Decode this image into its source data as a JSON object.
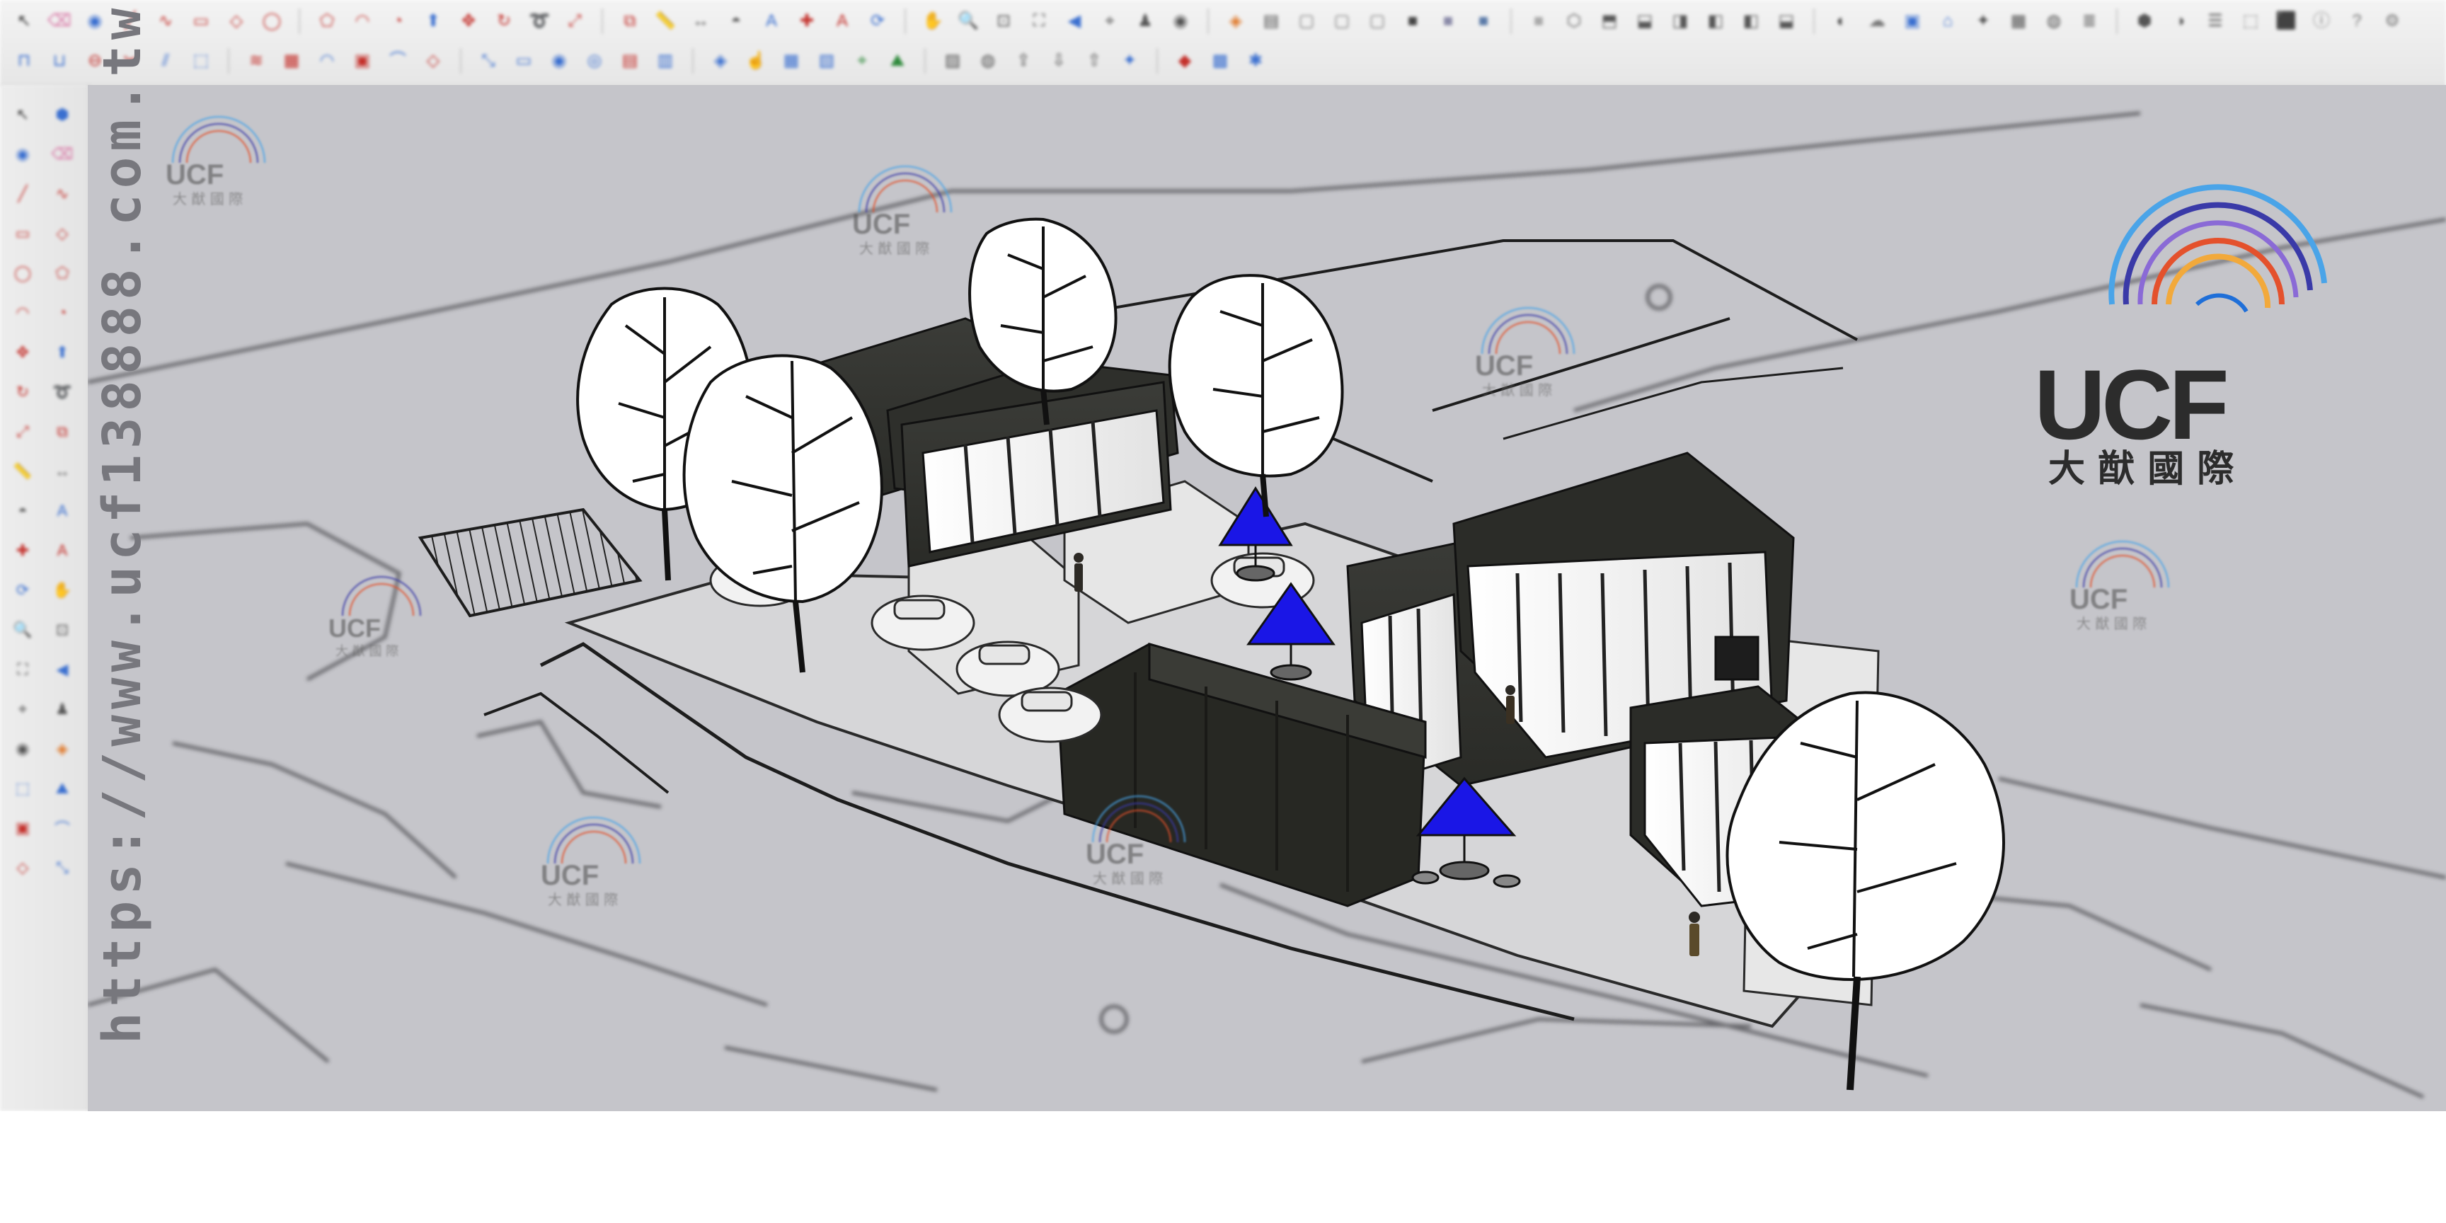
{
  "app": {
    "name": "SketchUp"
  },
  "toolbar_top": {
    "row1": [
      {
        "icon": "select-icon",
        "glyph": "↖",
        "color": "#333333"
      },
      {
        "icon": "eraser-icon",
        "glyph": "⌫",
        "color": "#d86fa1"
      },
      {
        "icon": "paint-bucket-icon",
        "glyph": "◉",
        "color": "#3a6fd0"
      },
      {
        "icon": "line-icon",
        "glyph": "╱",
        "color": "#c4302b"
      },
      {
        "icon": "freehand-icon",
        "glyph": "∿",
        "color": "#c4302b"
      },
      {
        "icon": "rectangle-icon",
        "glyph": "▭",
        "color": "#c4302b"
      },
      {
        "icon": "rotated-rectangle-icon",
        "glyph": "◇",
        "color": "#c4302b"
      },
      {
        "icon": "circle-icon",
        "glyph": "◯",
        "color": "#c4302b"
      },
      {
        "icon": "polygon-icon",
        "glyph": "⬠",
        "color": "#c4302b"
      },
      {
        "icon": "arc-icon",
        "glyph": "◠",
        "color": "#c4302b"
      },
      {
        "icon": "pie-icon",
        "glyph": "◔",
        "color": "#c4302b"
      },
      {
        "icon": "push-pull-icon",
        "glyph": "⬆",
        "color": "#3a6fd0"
      },
      {
        "icon": "move-icon",
        "glyph": "✥",
        "color": "#c4302b"
      },
      {
        "icon": "rotate-icon",
        "glyph": "↻",
        "color": "#c4302b"
      },
      {
        "icon": "follow-me-icon",
        "glyph": "➰",
        "color": "#c4302b"
      },
      {
        "icon": "scale-icon",
        "glyph": "⤢",
        "color": "#c4302b"
      },
      {
        "icon": "offset-icon",
        "glyph": "⧉",
        "color": "#c4302b"
      },
      {
        "icon": "tape-measure-icon",
        "glyph": "📏",
        "color": "#555555"
      },
      {
        "icon": "dimension-icon",
        "glyph": "↔",
        "color": "#555555"
      },
      {
        "icon": "protractor-icon",
        "glyph": "◓",
        "color": "#555555"
      },
      {
        "icon": "text-icon",
        "glyph": "A",
        "color": "#3a6fd0"
      },
      {
        "icon": "axes-icon",
        "glyph": "✚",
        "color": "#c4302b"
      },
      {
        "icon": "3d-text-icon",
        "glyph": "A",
        "color": "#c4302b"
      },
      {
        "icon": "orbit-icon",
        "glyph": "⟳",
        "color": "#3a6fd0"
      },
      {
        "icon": "pan-icon",
        "glyph": "✋",
        "color": "#3a6fd0"
      },
      {
        "icon": "zoom-icon",
        "glyph": "🔍",
        "color": "#555555"
      },
      {
        "icon": "zoom-window-icon",
        "glyph": "⊡",
        "color": "#555555"
      },
      {
        "icon": "zoom-extents-icon",
        "glyph": "⛶",
        "color": "#555555"
      },
      {
        "icon": "previous-view-icon",
        "glyph": "◀",
        "color": "#3a6fd0"
      },
      {
        "icon": "position-camera-icon",
        "glyph": "⌖",
        "color": "#555555"
      },
      {
        "icon": "walk-icon",
        "glyph": "♟",
        "color": "#555555"
      },
      {
        "icon": "look-around-icon",
        "glyph": "◉",
        "color": "#555555"
      },
      {
        "icon": "section-plane-icon",
        "glyph": "◈",
        "color": "#e07a2c"
      },
      {
        "icon": "display-section-icon",
        "glyph": "▤",
        "color": "#555555"
      },
      {
        "icon": "x-ray-icon",
        "glyph": "▢",
        "color": "#777777"
      },
      {
        "icon": "back-edges-icon",
        "glyph": "▢",
        "color": "#777777"
      },
      {
        "icon": "wireframe-icon",
        "glyph": "▢",
        "color": "#777777"
      },
      {
        "icon": "hidden-line-icon",
        "glyph": "■",
        "color": "#444444"
      },
      {
        "icon": "shaded-icon",
        "glyph": "■",
        "color": "#8a8aa8"
      },
      {
        "icon": "shaded-textures-icon",
        "glyph": "■",
        "color": "#5a7aa8"
      },
      {
        "icon": "monochrome-icon",
        "glyph": "■",
        "color": "#aaaaaa"
      },
      {
        "icon": "iso-view-icon",
        "glyph": "⬡",
        "color": "#555555"
      },
      {
        "icon": "top-view-icon",
        "glyph": "⬒",
        "color": "#555555"
      },
      {
        "icon": "front-view-icon",
        "glyph": "⬓",
        "color": "#555555"
      },
      {
        "icon": "right-view-icon",
        "glyph": "◨",
        "color": "#555555"
      },
      {
        "icon": "back-view-icon",
        "glyph": "◧",
        "color": "#555555"
      },
      {
        "icon": "left-view-icon",
        "glyph": "◧",
        "color": "#555555"
      },
      {
        "icon": "bottom-view-icon",
        "glyph": "⬓",
        "color": "#555555"
      },
      {
        "icon": "shadows-icon",
        "glyph": "◐",
        "color": "#444444"
      },
      {
        "icon": "fog-icon",
        "glyph": "☁",
        "color": "#777777"
      },
      {
        "icon": "match-photo-icon",
        "glyph": "▣",
        "color": "#3a6fd0"
      },
      {
        "icon": "warehouse-icon",
        "glyph": "⌂",
        "color": "#3a6fd0"
      },
      {
        "icon": "extension-icon",
        "glyph": "✦",
        "color": "#555555"
      },
      {
        "icon": "layout-icon",
        "glyph": "▦",
        "color": "#555555"
      },
      {
        "icon": "styles-icon",
        "glyph": "◍",
        "color": "#555555"
      },
      {
        "icon": "layers-icon",
        "glyph": "≣",
        "color": "#555555"
      },
      {
        "icon": "components-icon",
        "glyph": "⬢",
        "color": "#555555"
      },
      {
        "icon": "materials-icon",
        "glyph": "◑",
        "color": "#555555"
      },
      {
        "icon": "outliner-icon",
        "glyph": "☰",
        "color": "#555555"
      },
      {
        "icon": "sandbox-icon",
        "glyph": "⬚",
        "color": "#777777"
      },
      {
        "icon": "solid-tools-icon",
        "glyph": "⬛",
        "color": "#777777"
      },
      {
        "icon": "entity-info-icon",
        "glyph": "ⓘ",
        "color": "#777777"
      },
      {
        "icon": "instructor-icon",
        "glyph": "?",
        "color": "#777777"
      },
      {
        "icon": "settings-icon",
        "glyph": "⚙",
        "color": "#777777"
      }
    ],
    "row2": [
      {
        "icon": "intersect-icon",
        "glyph": "⊓",
        "color": "#3a6fd0"
      },
      {
        "icon": "union-icon",
        "glyph": "⊔",
        "color": "#3a6fd0"
      },
      {
        "icon": "subtract-icon",
        "glyph": "⊖",
        "color": "#c4302b"
      },
      {
        "icon": "trim-icon",
        "glyph": "✂",
        "color": "#c4302b"
      },
      {
        "icon": "split-icon",
        "glyph": "⫽",
        "color": "#3a6fd0"
      },
      {
        "icon": "outer-shell-icon",
        "glyph": "⬚",
        "color": "#3a6fd0"
      },
      {
        "icon": "from-contours-icon",
        "glyph": "≋",
        "color": "#c4302b"
      },
      {
        "icon": "from-scratch-icon",
        "glyph": "▦",
        "color": "#c4302b"
      },
      {
        "icon": "smoove-icon",
        "glyph": "◠",
        "color": "#3a6fd0"
      },
      {
        "icon": "stamp-icon",
        "glyph": "▣",
        "color": "#c4302b"
      },
      {
        "icon": "drape-icon",
        "glyph": "⌒",
        "color": "#3a6fd0"
      },
      {
        "icon": "add-detail-icon",
        "glyph": "◇",
        "color": "#c4302b"
      },
      {
        "icon": "flip-edge-icon",
        "glyph": "⤡",
        "color": "#3a6fd0"
      },
      {
        "icon": "front-elevation-icon",
        "glyph": "▭",
        "color": "#3a6fd0"
      },
      {
        "icon": "advanced-camera-icon",
        "glyph": "◉",
        "color": "#3a6fd0"
      },
      {
        "icon": "camera-lens-icon",
        "glyph": "◎",
        "color": "#3a6fd0"
      },
      {
        "icon": "photo-texture-icon",
        "glyph": "▤",
        "color": "#c4302b"
      },
      {
        "icon": "generate-report-icon",
        "glyph": "▥",
        "color": "#3a6fd0"
      },
      {
        "icon": "dynamic-component-icon",
        "glyph": "◈",
        "color": "#3a6fd0"
      },
      {
        "icon": "interact-icon",
        "glyph": "☝",
        "color": "#3a6fd0"
      },
      {
        "icon": "component-options-icon",
        "glyph": "▦",
        "color": "#3a6fd0"
      },
      {
        "icon": "component-attributes-icon",
        "glyph": "▧",
        "color": "#3a6fd0"
      },
      {
        "icon": "location-icon",
        "glyph": "⌖",
        "color": "#2f8a3c"
      },
      {
        "icon": "terrain-icon",
        "glyph": "⛰",
        "color": "#2f8a3c"
      },
      {
        "icon": "photo-textures-icon",
        "glyph": "▨",
        "color": "#555555"
      },
      {
        "icon": "preview-google-earth-icon",
        "glyph": "◍",
        "color": "#555555"
      },
      {
        "icon": "share-model-icon",
        "glyph": "⇪",
        "color": "#555555"
      },
      {
        "icon": "get-models-icon",
        "glyph": "⇩",
        "color": "#555555"
      },
      {
        "icon": "share-component-icon",
        "glyph": "⇧",
        "color": "#555555"
      },
      {
        "icon": "extension-warehouse-icon",
        "glyph": "✦",
        "color": "#3a6fd0"
      },
      {
        "icon": "ruby-console-icon",
        "glyph": "◆",
        "color": "#c4302b"
      },
      {
        "icon": "pack-icon",
        "glyph": "▩",
        "color": "#3a6fd0"
      },
      {
        "icon": "extra-tool-icon",
        "glyph": "✱",
        "color": "#3a6fd0"
      }
    ]
  },
  "toolbar_left": [
    {
      "icon": "select-icon",
      "glyph": "↖",
      "color": "#333333"
    },
    {
      "icon": "make-component-icon",
      "glyph": "⬢",
      "color": "#3a6fd0"
    },
    {
      "icon": "paint-bucket-icon",
      "glyph": "◉",
      "color": "#3a6fd0"
    },
    {
      "icon": "eraser-icon",
      "glyph": "⌫",
      "color": "#d86fa1"
    },
    {
      "icon": "line-icon",
      "glyph": "╱",
      "color": "#c4302b"
    },
    {
      "icon": "freehand-icon",
      "glyph": "∿",
      "color": "#c4302b"
    },
    {
      "icon": "rectangle-icon",
      "glyph": "▭",
      "color": "#c4302b"
    },
    {
      "icon": "rotated-rectangle-icon",
      "glyph": "◇",
      "color": "#c4302b"
    },
    {
      "icon": "circle-icon",
      "glyph": "◯",
      "color": "#c4302b"
    },
    {
      "icon": "polygon-icon",
      "glyph": "⬠",
      "color": "#c4302b"
    },
    {
      "icon": "arc-icon",
      "glyph": "◠",
      "color": "#c4302b"
    },
    {
      "icon": "pie-icon",
      "glyph": "◔",
      "color": "#c4302b"
    },
    {
      "icon": "move-icon",
      "glyph": "✥",
      "color": "#c4302b"
    },
    {
      "icon": "push-pull-icon",
      "glyph": "⬆",
      "color": "#3a6fd0"
    },
    {
      "icon": "rotate-icon",
      "glyph": "↻",
      "color": "#c4302b"
    },
    {
      "icon": "follow-me-icon",
      "glyph": "➰",
      "color": "#c4302b"
    },
    {
      "icon": "scale-icon",
      "glyph": "⤢",
      "color": "#c4302b"
    },
    {
      "icon": "offset-icon",
      "glyph": "⧉",
      "color": "#c4302b"
    },
    {
      "icon": "tape-measure-icon",
      "glyph": "📏",
      "color": "#555555"
    },
    {
      "icon": "dimension-icon",
      "glyph": "↔",
      "color": "#555555"
    },
    {
      "icon": "protractor-icon",
      "glyph": "◓",
      "color": "#555555"
    },
    {
      "icon": "text-icon",
      "glyph": "A",
      "color": "#3a6fd0"
    },
    {
      "icon": "axes-icon",
      "glyph": "✚",
      "color": "#c4302b"
    },
    {
      "icon": "3d-text-icon",
      "glyph": "A",
      "color": "#c4302b"
    },
    {
      "icon": "orbit-icon",
      "glyph": "⟳",
      "color": "#3a6fd0"
    },
    {
      "icon": "pan-icon",
      "glyph": "✋",
      "color": "#3a6fd0"
    },
    {
      "icon": "zoom-icon",
      "glyph": "🔍",
      "color": "#555555"
    },
    {
      "icon": "zoom-window-icon",
      "glyph": "⊡",
      "color": "#555555"
    },
    {
      "icon": "zoom-extents-icon",
      "glyph": "⛶",
      "color": "#555555"
    },
    {
      "icon": "previous-view-icon",
      "glyph": "◀",
      "color": "#3a6fd0"
    },
    {
      "icon": "position-camera-icon",
      "glyph": "⌖",
      "color": "#555555"
    },
    {
      "icon": "walk-icon",
      "glyph": "♟",
      "color": "#555555"
    },
    {
      "icon": "look-around-icon",
      "glyph": "◉",
      "color": "#555555"
    },
    {
      "icon": "section-plane-icon",
      "glyph": "◈",
      "color": "#e07a2c"
    },
    {
      "icon": "sandbox-icon",
      "glyph": "⬚",
      "color": "#3a6fd0"
    },
    {
      "icon": "terrain-icon",
      "glyph": "⛰",
      "color": "#3a6fd0"
    },
    {
      "icon": "stamp-icon",
      "glyph": "▣",
      "color": "#c4302b"
    },
    {
      "icon": "drape-icon",
      "glyph": "⌒",
      "color": "#3a6fd0"
    },
    {
      "icon": "add-detail-icon",
      "glyph": "◇",
      "color": "#c4302b"
    },
    {
      "icon": "flip-edge-icon",
      "glyph": "⤡",
      "color": "#3a6fd0"
    }
  ],
  "watermark": {
    "url": "https://www.ucf138888.com.tw/",
    "brand": "UCF",
    "brand_cn": "大 猷 國 際",
    "brand_cn_small": "大 猷 國 際"
  },
  "colors": {
    "viewport_bg": "#c5c5ca",
    "ground": "#d0d0d3",
    "container_dark": "#2b2c28",
    "umbrella_blue": "#1a16e6",
    "logo_arcs": [
      "#1f6fd8",
      "#3a3aa8",
      "#e4512c",
      "#f2a93b",
      "#8a6ad6",
      "#4aa4e8"
    ]
  },
  "model": {
    "trees": 5,
    "containers": 5,
    "cars": 5,
    "umbrellas": 3,
    "people": 3
  }
}
